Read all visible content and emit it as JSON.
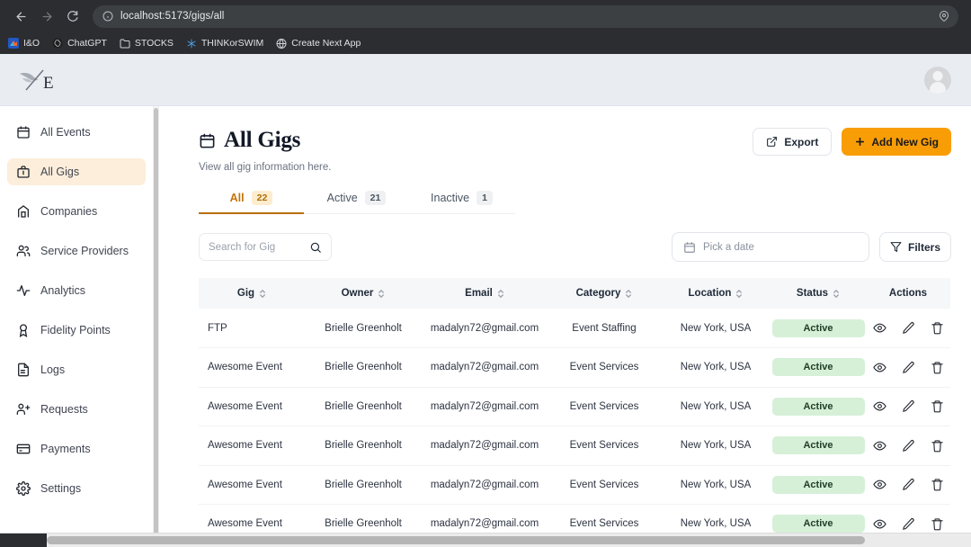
{
  "browser": {
    "url": "localhost:5173/gigs/all",
    "back_label": "Back",
    "forward_label": "Forward",
    "reload_label": "Reload",
    "site_info_label": "View site information",
    "location_icon_label": "Location",
    "bookmarks": [
      {
        "label": "I&O",
        "icon": "colorful-square-icon"
      },
      {
        "label": "ChatGPT",
        "icon": "chatgpt-icon"
      },
      {
        "label": "STOCKS",
        "icon": "folder-icon"
      },
      {
        "label": "THINKorSWIM",
        "icon": "thinkorswim-icon"
      },
      {
        "label": "Create Next App",
        "icon": "globe-icon"
      }
    ]
  },
  "app_header": {
    "brand_letter": "E",
    "brand_name": "Wing E",
    "avatar_label": "User account"
  },
  "sidebar": {
    "items": [
      {
        "label": "All Events",
        "icon": "calendar-icon",
        "active": false
      },
      {
        "label": "All Gigs",
        "icon": "briefcase-icon",
        "active": true
      },
      {
        "label": "Companies",
        "icon": "building-icon",
        "active": false
      },
      {
        "label": "Service Providers",
        "icon": "users-icon",
        "active": false
      },
      {
        "label": "Analytics",
        "icon": "activity-icon",
        "active": false
      },
      {
        "label": "Fidelity Points",
        "icon": "award-icon",
        "active": false
      },
      {
        "label": "Logs",
        "icon": "document-icon",
        "active": false
      },
      {
        "label": "Requests",
        "icon": "user-plus-icon",
        "active": false
      },
      {
        "label": "Payments",
        "icon": "credit-card-icon",
        "active": false
      },
      {
        "label": "Settings",
        "icon": "gear-icon",
        "active": false
      }
    ]
  },
  "page": {
    "title": "All Gigs",
    "subtitle": "View all gig information here.",
    "title_icon": "calendar-icon",
    "export_label": "Export",
    "add_label": "Add New Gig"
  },
  "tabs": [
    {
      "label": "All",
      "count": "22",
      "active": true
    },
    {
      "label": "Active",
      "count": "21",
      "active": false
    },
    {
      "label": "Inactive",
      "count": "1",
      "active": false
    }
  ],
  "filters": {
    "search_placeholder": "Search for Gig",
    "search_value": "",
    "date_placeholder": "Pick a date",
    "filters_label": "Filters"
  },
  "table": {
    "columns": [
      {
        "label": "Gig",
        "sortable": true
      },
      {
        "label": "Owner",
        "sortable": true
      },
      {
        "label": "Email",
        "sortable": true
      },
      {
        "label": "Category",
        "sortable": true
      },
      {
        "label": "Location",
        "sortable": true
      },
      {
        "label": "Status",
        "sortable": true
      },
      {
        "label": "Actions",
        "sortable": false
      }
    ],
    "rows": [
      {
        "gig": "FTP",
        "owner": "Brielle Greenholt",
        "email": "madalyn72@gmail.com",
        "category": "Event Staffing",
        "location": "New York, USA",
        "status": "Active"
      },
      {
        "gig": "Awesome Event",
        "owner": "Brielle Greenholt",
        "email": "madalyn72@gmail.com",
        "category": "Event Services",
        "location": "New York, USA",
        "status": "Active"
      },
      {
        "gig": "Awesome Event",
        "owner": "Brielle Greenholt",
        "email": "madalyn72@gmail.com",
        "category": "Event Services",
        "location": "New York, USA",
        "status": "Active"
      },
      {
        "gig": "Awesome Event",
        "owner": "Brielle Greenholt",
        "email": "madalyn72@gmail.com",
        "category": "Event Services",
        "location": "New York, USA",
        "status": "Active"
      },
      {
        "gig": "Awesome Event",
        "owner": "Brielle Greenholt",
        "email": "madalyn72@gmail.com",
        "category": "Event Services",
        "location": "New York, USA",
        "status": "Active"
      },
      {
        "gig": "Awesome Event",
        "owner": "Brielle Greenholt",
        "email": "madalyn72@gmail.com",
        "category": "Event Services",
        "location": "New York, USA",
        "status": "Active"
      }
    ],
    "row_actions": [
      {
        "name": "view",
        "icon": "eye-icon"
      },
      {
        "name": "edit",
        "icon": "pencil-icon"
      },
      {
        "name": "delete",
        "icon": "trash-icon"
      }
    ]
  },
  "colors": {
    "accent_orange": "#f99d07",
    "tab_active": "#b96f0c",
    "sidebar_active_bg": "#fceeda",
    "status_active_bg": "#d6f0d8",
    "header_bg": "#e9edf2"
  }
}
